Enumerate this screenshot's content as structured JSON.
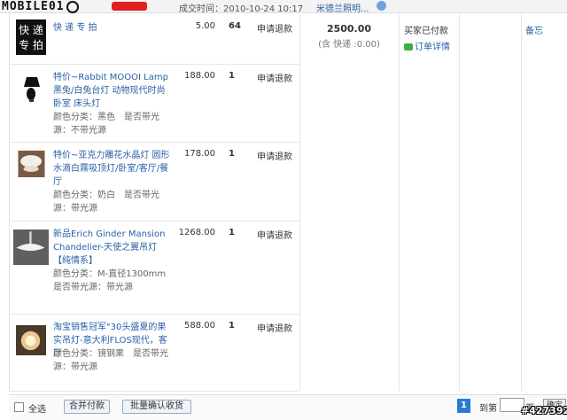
{
  "header": {
    "logo": "MOBILE01",
    "deal_time": "成交时间：2010-10-24 10:17",
    "shop_name": "米德兰照明...",
    "icons": [
      "wangwang-icon"
    ]
  },
  "items": [
    {
      "title": "快 递 专 拍",
      "spec": "",
      "price": "5.00",
      "qty": "64",
      "action": "申请退款",
      "thumb": "express-badge"
    },
    {
      "title": "特价~Rabbit MOOOI Lamp 黑兔/白兔台灯 动物现代时尚卧室 床头灯",
      "spec": "颜色分类：黑色　是否带光源：不带光源",
      "price": "188.00",
      "qty": "1",
      "action": "申请退款",
      "thumb": "rabbit-lamp"
    },
    {
      "title": "特价~亚克力雕花水晶灯 圆形水滴白霧吸顶灯/卧室/客厅/餐厅",
      "spec": "颜色分类：奶白　是否带光源：带光源",
      "price": "178.00",
      "qty": "1",
      "action": "申请退款",
      "thumb": "crystal-lamp"
    },
    {
      "title": "新品Erich Ginder Mansion Chandelier-天使之翼吊灯【纯情系】",
      "spec": "颜色分类：M-直径1300mm　是否带光源：带光源",
      "price": "1268.00",
      "qty": "1",
      "action": "申请退款",
      "thumb": "chandelier"
    },
    {
      "title": "淘宝销售冠军\"30头盛夏的果实吊灯-意大利FLOS现代，客厅",
      "spec": "颜色分类：镜钢果　是否带光源：带光源",
      "price": "588.00",
      "qty": "1",
      "action": "申请退款",
      "thumb": "fruit-lamp"
    }
  ],
  "order": {
    "total": "2500.00",
    "shipping": "(含 快递 :0.00)",
    "status": "买家已付款",
    "detail_link": "订单详情",
    "note": "备忘"
  },
  "footer": {
    "select_all": "全选",
    "merge_pay": "合并付款",
    "batch_confirm": "批量确认收货",
    "current_page": "1",
    "goto_label": "到第",
    "page_unit": "页",
    "ok": "确定"
  },
  "watermark": "#427392",
  "colors": {
    "link": "#2a5fa8",
    "page_active": "#2a7ad5"
  }
}
